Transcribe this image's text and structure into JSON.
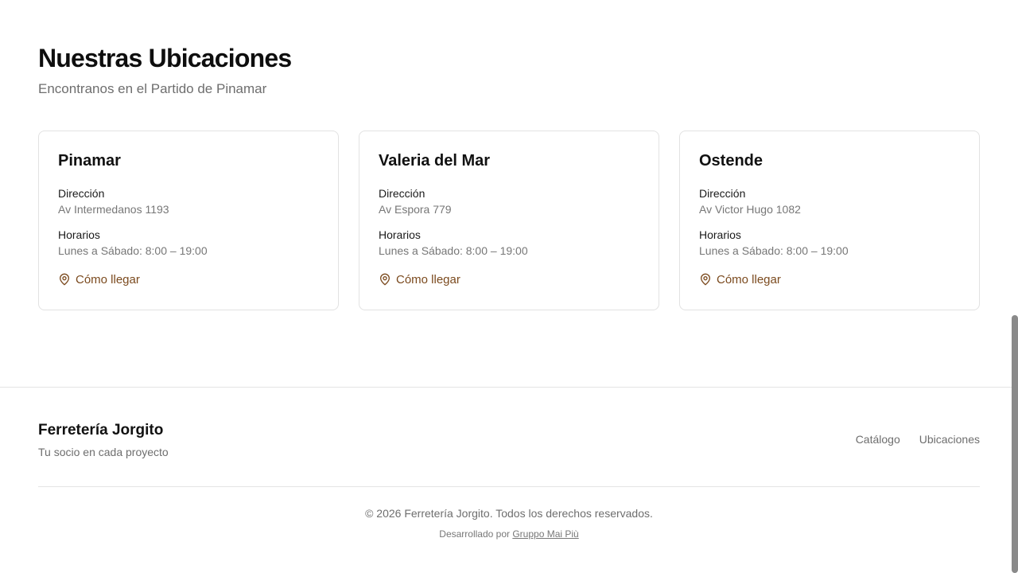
{
  "locations_section": {
    "title": "Nuestras Ubicaciones",
    "subtitle": "Encontranos en el Partido de Pinamar",
    "address_label": "Dirección",
    "hours_label": "Horarios",
    "directions_label": "Cómo llegar",
    "directions_icon": "map-pin-icon",
    "cards": [
      {
        "name": "Pinamar",
        "address": "Av Intermedanos 1193",
        "hours": "Lunes a Sábado: 8:00 – 19:00"
      },
      {
        "name": "Valeria del Mar",
        "address": "Av Espora 779",
        "hours": "Lunes a Sábado: 8:00 – 19:00"
      },
      {
        "name": "Ostende",
        "address": "Av Victor Hugo 1082",
        "hours": "Lunes a Sábado: 8:00 – 19:00"
      }
    ]
  },
  "footer": {
    "brand": "Ferretería Jorgito",
    "tagline": "Tu socio en cada proyecto",
    "nav": [
      "Catálogo",
      "Ubicaciones"
    ],
    "copyright": "© 2026 Ferretería Jorgito. Todos los derechos reservados.",
    "credit_prefix": "Desarrollado por",
    "credit_link": "Gruppo Mai Più"
  },
  "colors": {
    "accent": "#7b4a1e",
    "text": "#111111",
    "muted": "#6e6e6e",
    "border": "#e2e2e2"
  }
}
